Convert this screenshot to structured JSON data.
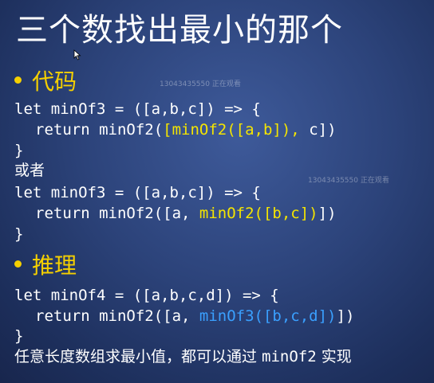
{
  "slide": {
    "title": "三个数找出最小的那个",
    "section1": "代码",
    "code1_l1": "let minOf3 = ([a,b,c]) => {",
    "code1_l2_pre": "return minOf2(",
    "code1_l2_hl": "[minOf2([a,b]),",
    "code1_l2_post": " c])",
    "code1_l3": "}",
    "or_label": "或者",
    "code2_l1": "let minOf3 = ([a,b,c]) => {",
    "code2_l2_pre": "return minOf2([a, ",
    "code2_l2_hl": "minOf2([b,c])",
    "code2_l2_post": "])",
    "code2_l3": "}",
    "section2": "推理",
    "code3_l1": "let minOf4 = ([a,b,c,d]) => {",
    "code3_l2_pre": "return minOf2([a, ",
    "code3_l2_hl": "minOf3([b,c,d])",
    "code3_l2_post": "])",
    "code3_l3": "}",
    "conclusion_pre": "任意长度数组求最小值，都可以通过 ",
    "conclusion_code": "minOf2",
    "conclusion_post": " 实现",
    "watermark1": "13043435550 正在观看",
    "watermark2": "13043435550 正在观看"
  },
  "colors": {
    "background": "#2c437a",
    "accent_yellow": "#f5d000",
    "accent_blue": "#3aa0ff"
  }
}
